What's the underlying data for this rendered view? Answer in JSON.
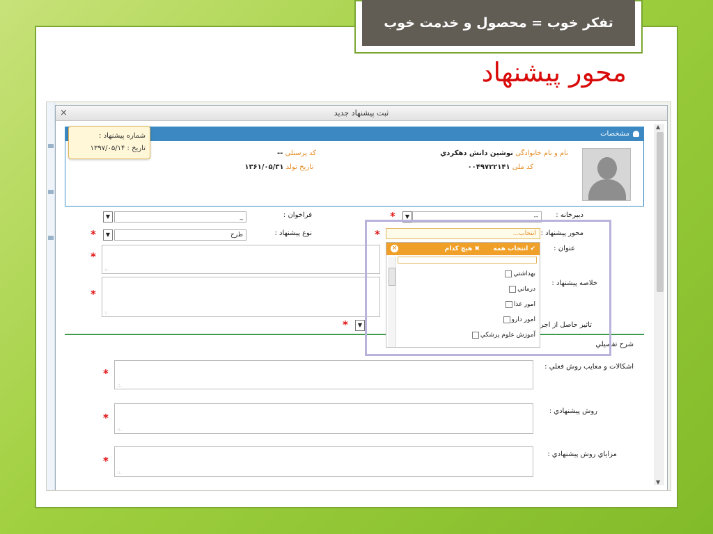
{
  "slide": {
    "banner_title": "تفکر خوب = محصول و خدمت خوب",
    "heading": "محور پیشنهاد"
  },
  "dialog": {
    "title": "ثبت پیشنهاد جدید",
    "close_icon": "×"
  },
  "personal": {
    "header": "مشخصات",
    "name_label": "نام و نام خانوادگی",
    "name_value": "نوشین دانش دهکردي",
    "national_code_label": "کد ملی",
    "national_code_value": "۰۰۴۹۷۲۲۱۴۱",
    "personnel_code_label": "کد پرسنلی",
    "personnel_code_value": "--",
    "birth_date_label": "تاریخ تولد",
    "birth_date_value": "۱۳۶۱/۰۵/۳۱",
    "proposal_number_label": "شماره پیشنهاد :",
    "proposal_date_label": "تاریخ :",
    "proposal_date_value": "۱۳۹۷/۰۵/۱۴"
  },
  "form": {
    "secretariat_label": "دبیرخانه :",
    "secretariat_value": "--",
    "call_label": "فراخوان :",
    "call_value": "_",
    "axis_label": "محور پیشنهاد :",
    "axis_placeholder": "انتخاب...",
    "type_label": "نوع پیشنهاد :",
    "type_value": "طرح",
    "title_label": "عنوان :",
    "summary_label": "خلاصه پیشنهاد :",
    "effect_label": "تاثیر حاصل از اجرا :",
    "required_mark": "*",
    "resize_mark": "::.",
    "select_arrow": "▼"
  },
  "dropdown": {
    "select_all": "✔ انتخاب همه",
    "select_none": "✖ هیچ کدام",
    "close": "×",
    "items": [
      "بهداشتي",
      "درماني",
      "امور غذا",
      "امور دارو",
      "آموزش علوم پزشکي"
    ]
  },
  "details": {
    "section_title": "شرح تفصيلي",
    "problems_label": "اشکالات و معایب روش فعلي :",
    "proposed_method_label": "روش پیشنهادي :",
    "advantages_label": "مزایاي روش پیشنهادي :"
  }
}
